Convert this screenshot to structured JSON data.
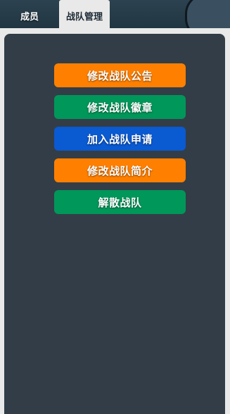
{
  "tabs": {
    "members_label": "成员",
    "team_manage_label": "战队管理"
  },
  "actions": {
    "edit_notice": "修改战队公告",
    "edit_badge": "修改战队徽章",
    "join_requests": "加入战队申请",
    "edit_intro": "修改战队简介",
    "disband": "解散战队"
  },
  "colors": {
    "orange": "#ff8000",
    "green": "#00975a",
    "blue": "#0a5ad2",
    "panel": "#333d47"
  }
}
